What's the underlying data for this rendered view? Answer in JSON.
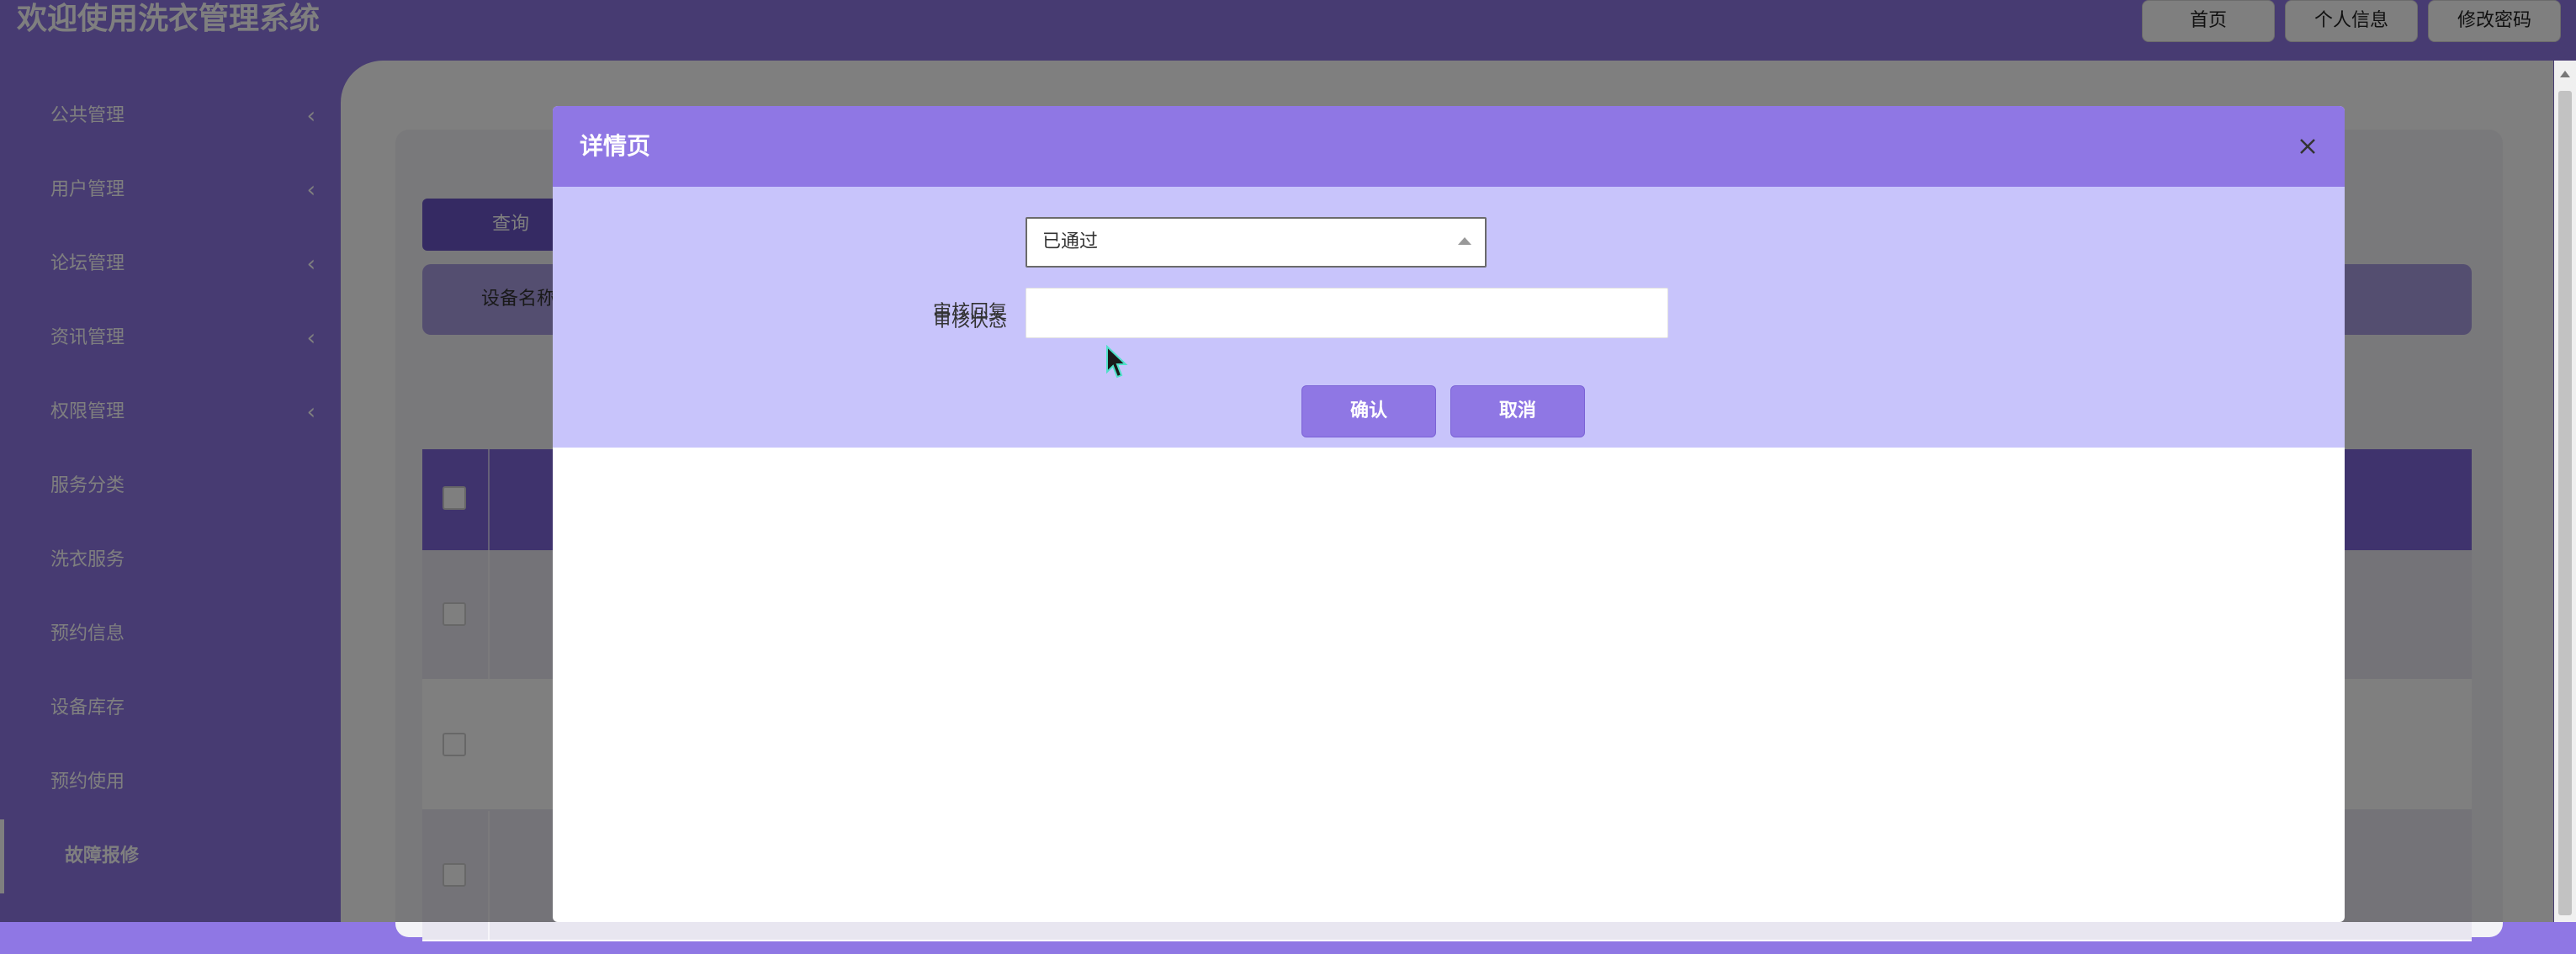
{
  "header": {
    "title": "欢迎使用洗衣管理系统",
    "buttons": {
      "home": "首页",
      "profile": "个人信息",
      "password": "修改密码"
    }
  },
  "sidebar": {
    "items": [
      {
        "label": "公共管理",
        "icon": "chevron-left-icon"
      },
      {
        "label": "用户管理",
        "icon": "chevron-left-icon"
      },
      {
        "label": "论坛管理",
        "icon": "chevron-left-icon"
      },
      {
        "label": "资讯管理",
        "icon": "chevron-left-icon"
      },
      {
        "label": "权限管理",
        "icon": "chevron-left-icon"
      },
      {
        "label": "服务分类"
      },
      {
        "label": "洗衣服务"
      },
      {
        "label": "预约信息"
      },
      {
        "label": "设备库存"
      },
      {
        "label": "预约使用"
      },
      {
        "label": "故障报修",
        "active": true
      }
    ]
  },
  "main": {
    "query_button": "查询",
    "search_label": "设备名称"
  },
  "modal": {
    "title": "详情页",
    "fields": {
      "status_label": "审核状态",
      "status_value": "已通过",
      "reply_label": "审核回复",
      "reply_value": ""
    },
    "confirm": "确认",
    "cancel": "取消"
  },
  "colors": {
    "primary": "#8f77e4",
    "form_bg": "#c8c4fb",
    "table_header": "#7e66da"
  }
}
